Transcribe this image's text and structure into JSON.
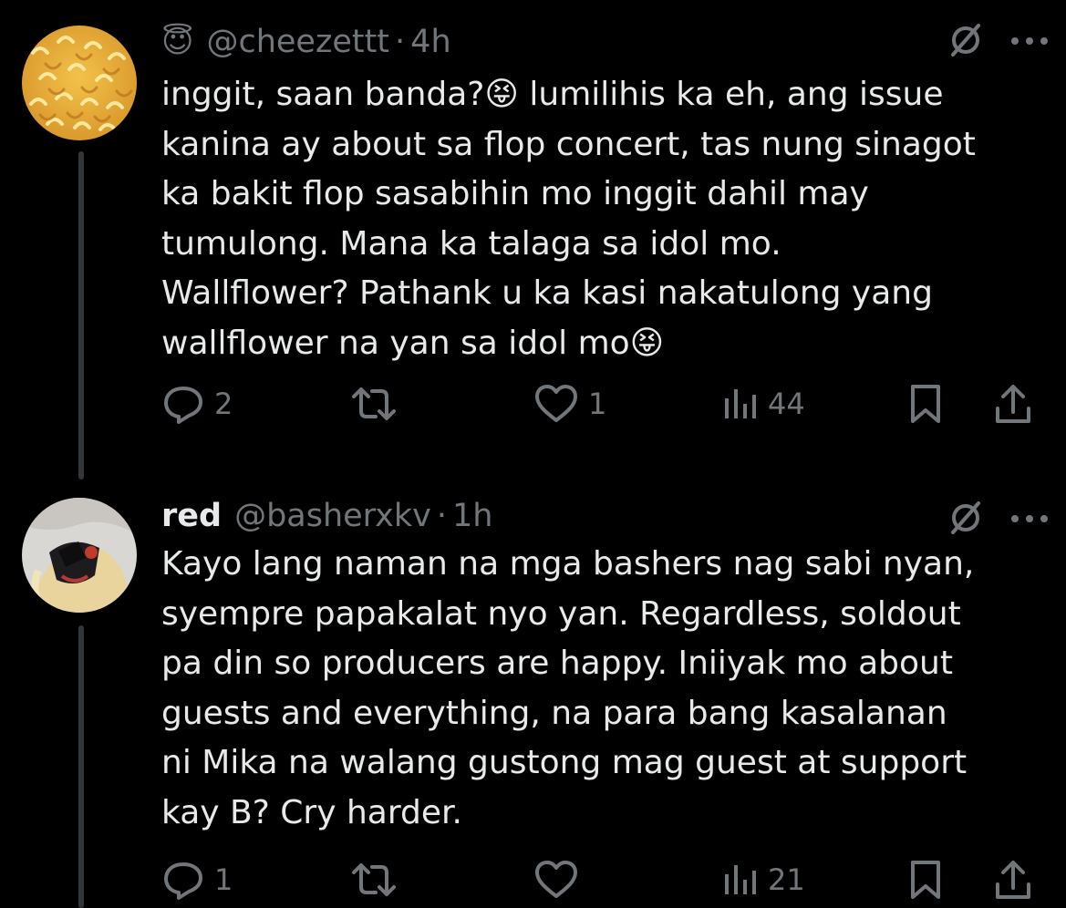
{
  "tweets": [
    {
      "handle": "@cheezettt",
      "dot": "·",
      "time": "4h",
      "badge_emoji": "😇",
      "text": "inggit, saan banda?😝 lumilihis ka eh, ang issue\nkanina ay about sa flop concert, tas nung sinagot\nka bakit flop sasabihin mo inggit dahil may\ntumulong. Mana ka talaga sa idol mo.\nWallflower? Pathank u ka kasi nakatulong yang\nwallflower na yan sa idol mo😝",
      "replies": "2",
      "likes": "1",
      "views": "44"
    },
    {
      "display_name": "red",
      "handle": "@basherxkv",
      "dot": "·",
      "time": "1h",
      "text": "Kayo lang naman na mga bashers nag sabi nyan,\nsyempre papakalat nyo yan. Regardless, soldout\npa din so producers are happy. Iniiyak mo about\nguests and everything, na para bang kasalanan\nni Mika na walang gustong mag guest at support\nkay B? Cry harder.",
      "replies": "1",
      "views": "21"
    }
  ],
  "colors": {
    "background": "#000000",
    "text": "#e7e9ea",
    "muted": "#71767b",
    "thread_line": "#333639"
  },
  "icons": [
    "grok-icon",
    "more-icon",
    "reply-icon",
    "retweet-icon",
    "like-icon",
    "views-icon",
    "bookmark-icon",
    "share-icon"
  ]
}
